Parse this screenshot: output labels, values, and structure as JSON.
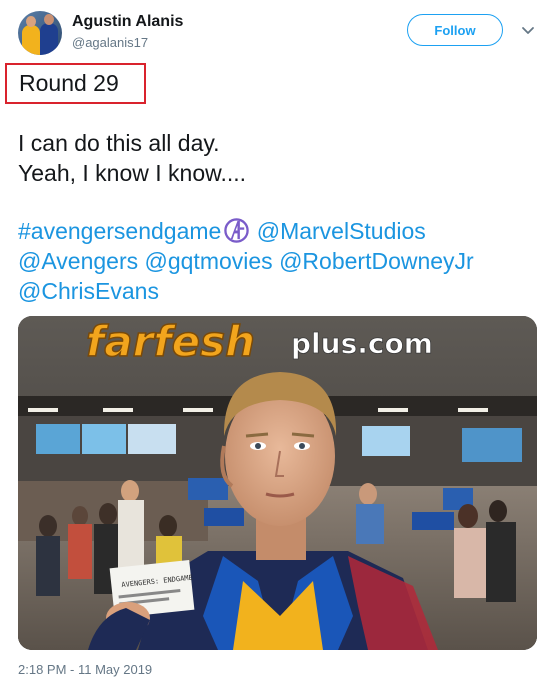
{
  "user": {
    "name": "Agustin Alanis",
    "handle": "@agalanis17"
  },
  "follow_label": "Follow",
  "highlight_label": "Round 29",
  "tweet": {
    "lines": [
      "I can do this all day.",
      "Yeah, I know I know...."
    ],
    "tag_lines": [
      [
        "#avengersendgame",
        "@MarvelStudios"
      ],
      [
        "@Avengers",
        "@gqtmovies",
        "@RobertDowneyJr"
      ],
      [
        "@ChrisEvans"
      ]
    ],
    "emoji": "avengers-logo-icon"
  },
  "photo": {
    "watermark_main": "farfesh",
    "watermark_suffix": "plus.com",
    "ticket_text": "AVENGERS: ENDGAME"
  },
  "timestamp": "2:18 PM - 11 May 2019",
  "colors": {
    "link": "#1b95e0",
    "follow": "#1da1f2",
    "highlight_border": "#d9232d",
    "secondary_text": "#657786"
  }
}
